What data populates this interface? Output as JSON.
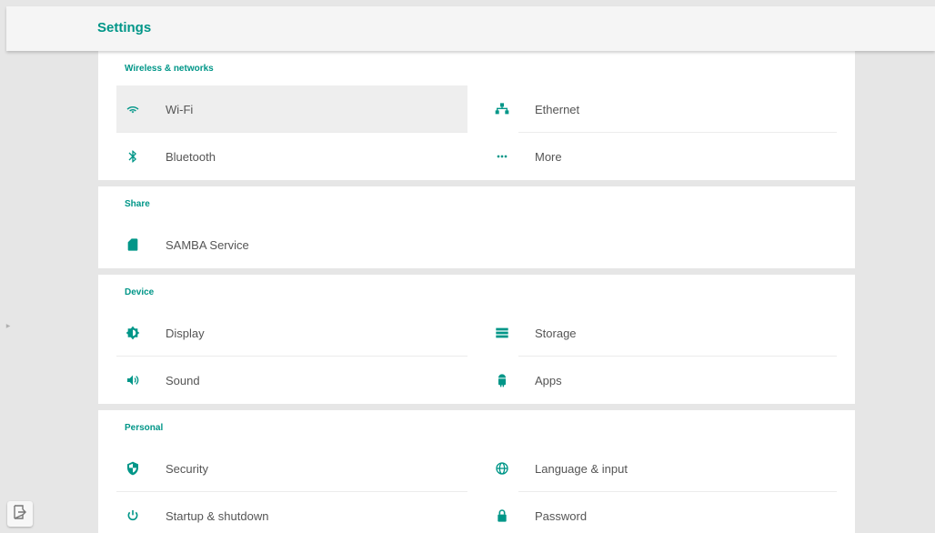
{
  "appbar": {
    "title": "Settings"
  },
  "colors": {
    "accent": "#009688",
    "background": "#e6e6e6",
    "card": "#ffffff"
  },
  "sections": [
    {
      "title": "Wireless & networks",
      "items": [
        {
          "label": "Wi-Fi",
          "icon": "wifi-icon",
          "selected": true
        },
        {
          "label": "Ethernet",
          "icon": "ethernet-icon"
        },
        {
          "label": "Bluetooth",
          "icon": "bluetooth-icon"
        },
        {
          "label": "More",
          "icon": "more-icon"
        }
      ]
    },
    {
      "title": "Share",
      "items": [
        {
          "label": "SAMBA Service",
          "icon": "sd-card-icon"
        }
      ]
    },
    {
      "title": "Device",
      "items": [
        {
          "label": "Display",
          "icon": "brightness-icon"
        },
        {
          "label": "Storage",
          "icon": "storage-icon"
        },
        {
          "label": "Sound",
          "icon": "volume-icon"
        },
        {
          "label": "Apps",
          "icon": "android-icon"
        }
      ]
    },
    {
      "title": "Personal",
      "items": [
        {
          "label": "Security",
          "icon": "shield-icon"
        },
        {
          "label": "Language & input",
          "icon": "globe-icon"
        },
        {
          "label": "Startup & shutdown",
          "icon": "power-icon"
        },
        {
          "label": "Password",
          "icon": "lock-icon"
        }
      ]
    }
  ],
  "side": {
    "handle_icon": "chevron-right-icon",
    "exit_icon": "exit-icon"
  }
}
